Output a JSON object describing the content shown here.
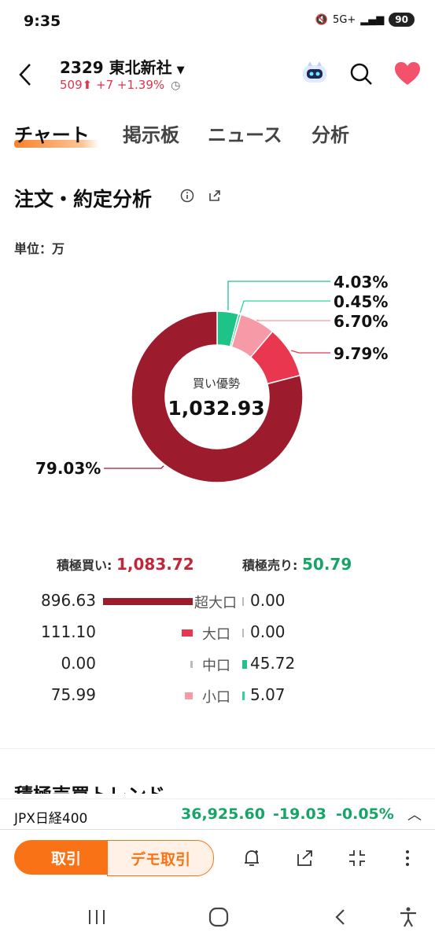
{
  "status": {
    "time": "9:35",
    "battery": "90",
    "network": "5G+"
  },
  "header": {
    "code_name": "2329 東北新社",
    "price": "509",
    "change": "+7",
    "change_pct": "+1.39%"
  },
  "tabs": [
    "チャート",
    "掲示板",
    "ニュース",
    "分析"
  ],
  "section": {
    "title": "注文・約定分析",
    "unit": "単位：万"
  },
  "donut": {
    "center_label": "買い優勢",
    "center_value": "1,032.93",
    "slices": [
      {
        "label": "4.03%",
        "value": 4.03,
        "color": "#1ec487"
      },
      {
        "label": "0.45%",
        "value": 0.45,
        "color": "#2fd49a"
      },
      {
        "label": "6.70%",
        "value": 6.7,
        "color": "#f59aa6"
      },
      {
        "label": "9.79%",
        "value": 9.79,
        "color": "#e8374f"
      },
      {
        "label": "79.03%",
        "value": 79.03,
        "color": "#9c1c2e"
      }
    ]
  },
  "totals": {
    "buy_label": "積極買い:",
    "buy_value": "1,083.72",
    "sell_label": "積極売り:",
    "sell_value": "50.79"
  },
  "rows": [
    {
      "buy": "896.63",
      "label": "超大口",
      "sell": "0.00",
      "buy_amount": 896.63,
      "sell_amount": 0.0,
      "buy_color": "#9c1c2e",
      "sell_color": "#17a567"
    },
    {
      "buy": "111.10",
      "label": "大口",
      "sell": "0.00",
      "buy_amount": 111.1,
      "sell_amount": 0.0,
      "buy_color": "#e8374f",
      "sell_color": "#17a567"
    },
    {
      "buy": "0.00",
      "label": "中口",
      "sell": "45.72",
      "buy_amount": 0.0,
      "sell_amount": 45.72,
      "buy_color": "#f59aa6",
      "sell_color": "#1ec487"
    },
    {
      "buy": "75.99",
      "label": "小口",
      "sell": "5.07",
      "buy_amount": 75.99,
      "sell_amount": 5.07,
      "buy_color": "#f59aa6",
      "sell_color": "#2fd49a"
    }
  ],
  "next_section": {
    "title": "積極売買トレンド"
  },
  "ticker": {
    "name": "JPX日経400",
    "value": "36,925.60",
    "change": "-19.03",
    "change_pct": "-0.05%"
  },
  "bottom": {
    "trade": "取引",
    "demo": "デモ取引"
  }
}
